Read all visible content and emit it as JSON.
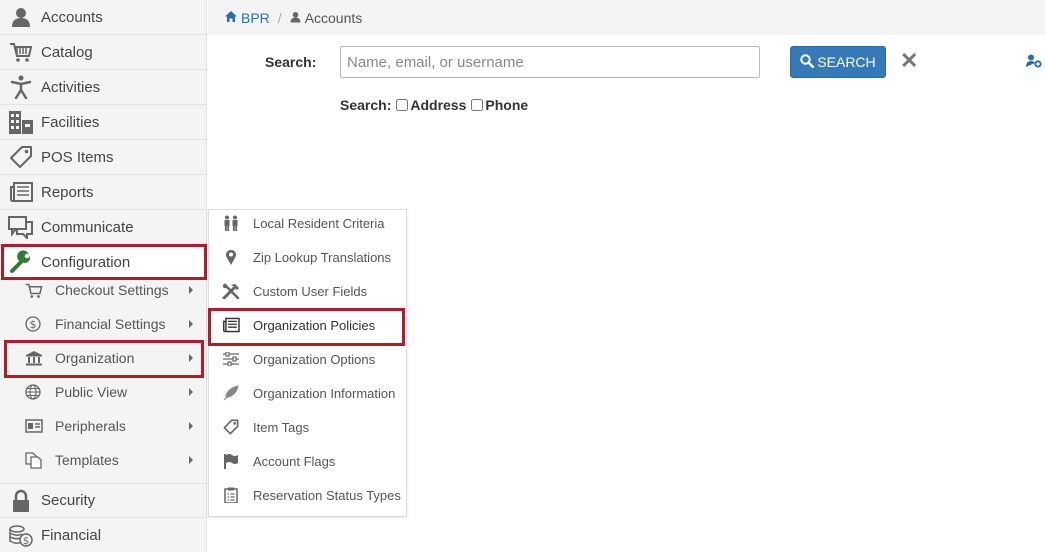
{
  "sidebar": {
    "items": [
      {
        "label": "Accounts",
        "icon": "user-icon"
      },
      {
        "label": "Catalog",
        "icon": "cart-icon"
      },
      {
        "label": "Activities",
        "icon": "person-activity-icon"
      },
      {
        "label": "Facilities",
        "icon": "building-icon"
      },
      {
        "label": "POS Items",
        "icon": "tag-icon"
      },
      {
        "label": "Reports",
        "icon": "newspaper-icon"
      },
      {
        "label": "Communicate",
        "icon": "chat-icon"
      },
      {
        "label": "Configuration",
        "icon": "wrench-icon"
      },
      {
        "label": "Security",
        "icon": "lock-icon"
      },
      {
        "label": "Financial",
        "icon": "coins-icon"
      }
    ],
    "config_subitems": [
      {
        "label": "Checkout Settings",
        "icon": "cart-icon"
      },
      {
        "label": "Financial Settings",
        "icon": "dollar-circle-icon"
      },
      {
        "label": "Organization",
        "icon": "bank-icon"
      },
      {
        "label": "Public View",
        "icon": "globe-icon"
      },
      {
        "label": "Peripherals",
        "icon": "id-card-icon"
      },
      {
        "label": "Templates",
        "icon": "copy-icon"
      }
    ]
  },
  "breadcrumb": {
    "home": "BPR",
    "separator": "/",
    "current": "Accounts"
  },
  "search": {
    "label": "Search:",
    "placeholder": "Name, email, or username",
    "value": "",
    "button_label": "SEARCH",
    "clear_symbol": "✕",
    "filter_label": "Search:",
    "filters": [
      "Address",
      "Phone"
    ]
  },
  "flyout": {
    "items": [
      {
        "label": "Local Resident Criteria",
        "icon": "people-icon"
      },
      {
        "label": "Zip Lookup Translations",
        "icon": "map-pin-icon"
      },
      {
        "label": "Custom User Fields",
        "icon": "tools-icon"
      },
      {
        "label": "Organization Policies",
        "icon": "newspaper-icon"
      },
      {
        "label": "Organization Options",
        "icon": "sliders-icon"
      },
      {
        "label": "Organization Information",
        "icon": "feather-icon"
      },
      {
        "label": "Item Tags",
        "icon": "tag-icon"
      },
      {
        "label": "Account Flags",
        "icon": "flag-icon"
      },
      {
        "label": "Reservation Status Types",
        "icon": "clipboard-icon"
      }
    ]
  },
  "colors": {
    "accent": "#357ab7",
    "highlight": "#b41a2a",
    "link": "#2a6fad",
    "wrench": "#2e7d32"
  }
}
